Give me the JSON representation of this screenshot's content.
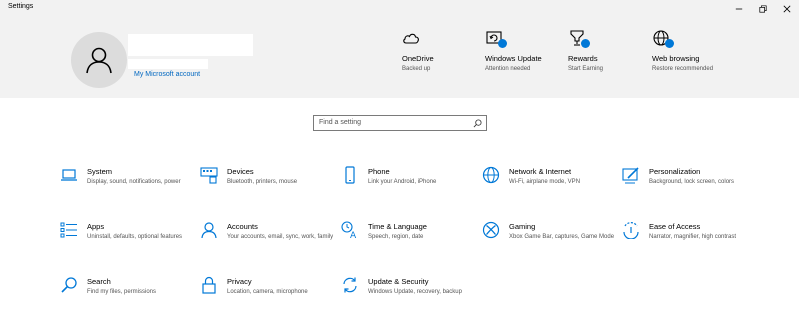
{
  "window": {
    "title": "Settings"
  },
  "account": {
    "link_label": "My Microsoft account"
  },
  "quick_links": [
    {
      "title": "OneDrive",
      "subtitle": "Backed up",
      "icon": "cloud-icon"
    },
    {
      "title": "Windows Update",
      "subtitle": "Attention needed",
      "icon": "windows-update-icon"
    },
    {
      "title": "Rewards",
      "subtitle": "Start Earning",
      "icon": "rewards-trophy-icon"
    },
    {
      "title": "Web browsing",
      "subtitle": "Restore recommended",
      "icon": "globe-icon"
    }
  ],
  "search": {
    "placeholder": "Find a setting"
  },
  "categories": [
    {
      "title": "System",
      "subtitle": "Display, sound, notifications, power",
      "icon": "laptop-icon"
    },
    {
      "title": "Devices",
      "subtitle": "Bluetooth, printers, mouse",
      "icon": "keyboard-devices-icon"
    },
    {
      "title": "Phone",
      "subtitle": "Link your Android, iPhone",
      "icon": "phone-icon"
    },
    {
      "title": "Network & Internet",
      "subtitle": "Wi-Fi, airplane mode, VPN",
      "icon": "globe-icon"
    },
    {
      "title": "Personalization",
      "subtitle": "Background, lock screen, colors",
      "icon": "paintbrush-icon"
    },
    {
      "title": "Apps",
      "subtitle": "Uninstall, defaults, optional features",
      "icon": "apps-list-icon"
    },
    {
      "title": "Accounts",
      "subtitle": "Your accounts, email, sync, work, family",
      "icon": "person-icon"
    },
    {
      "title": "Time & Language",
      "subtitle": "Speech, region, date",
      "icon": "time-language-icon"
    },
    {
      "title": "Gaming",
      "subtitle": "Xbox Game Bar, captures, Game Mode",
      "icon": "xbox-icon"
    },
    {
      "title": "Ease of Access",
      "subtitle": "Narrator, magnifier, high contrast",
      "icon": "ease-of-access-icon"
    },
    {
      "title": "Search",
      "subtitle": "Find my files, permissions",
      "icon": "search-icon"
    },
    {
      "title": "Privacy",
      "subtitle": "Location, camera, microphone",
      "icon": "lock-icon"
    },
    {
      "title": "Update & Security",
      "subtitle": "Windows Update, recovery, backup",
      "icon": "sync-arrows-icon"
    }
  ],
  "colors": {
    "accent": "#0078d7",
    "link": "#0067c0",
    "header_bg": "#f2f2f2"
  }
}
